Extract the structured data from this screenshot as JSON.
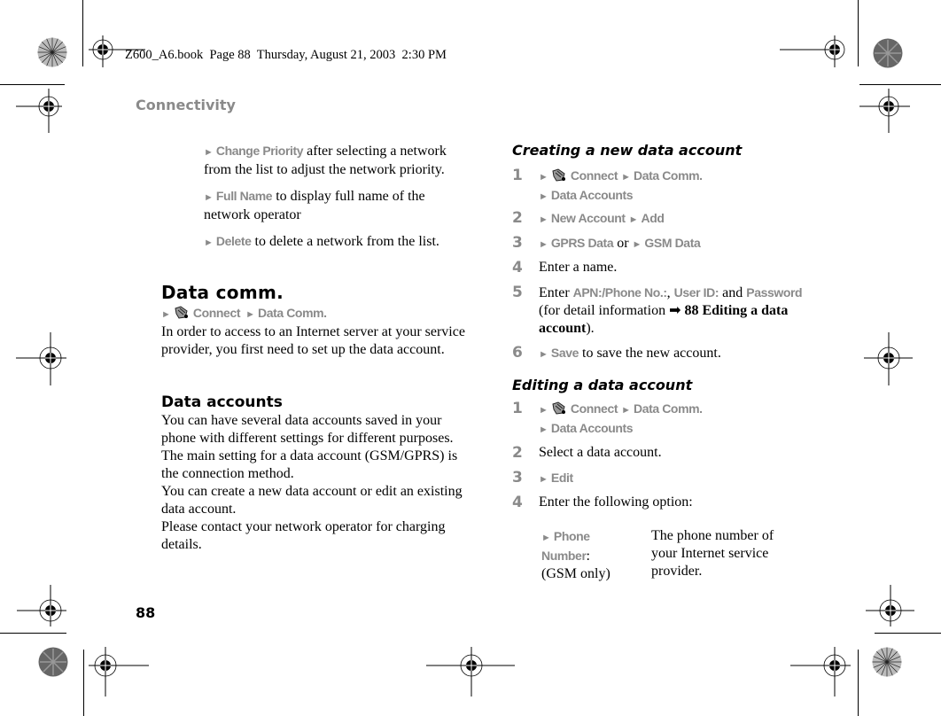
{
  "print_header": "Z600_A6.book  Page 88  Thursday, August 21, 2003  2:30 PM",
  "section_title": "Connectivity",
  "page_number": "88",
  "left_column": {
    "options": [
      {
        "menu": "Change Priority",
        "text": " after selecting a network from the list to adjust the network priority."
      },
      {
        "menu": "Full Name",
        "text": " to display full name of the network operator"
      },
      {
        "menu": "Delete",
        "text": " to delete a network from the list."
      }
    ],
    "data_comm": {
      "heading": "Data comm.",
      "path": {
        "item1": "Connect",
        "item2": "Data Comm."
      },
      "body": "In order to access to an Internet server at your service provider, you first need to set up the data account."
    },
    "data_accounts": {
      "heading": "Data accounts",
      "para1": "You can have several data accounts saved in your phone with different settings for different purposes. The main setting for a data account (GSM/GPRS) is the connection method.",
      "para2": "You can create a new data account or edit an existing data account.",
      "para3": "Please contact your network operator for charging details."
    }
  },
  "right_column": {
    "creating": {
      "heading": "Creating a new data account",
      "steps": [
        {
          "num": "1",
          "a": "Connect",
          "b": "Data Comm.",
          "c": "Data Accounts"
        },
        {
          "num": "2",
          "a": "New Account",
          "b": "Add"
        },
        {
          "num": "3",
          "a": "GPRS Data",
          "or": " or ",
          "b": "GSM Data"
        },
        {
          "num": "4",
          "text": "Enter a name."
        },
        {
          "num": "5",
          "prefix": "Enter ",
          "f1": "APN:/Phone No.:",
          "sep": ", ",
          "f2": "User ID:",
          "and": " and ",
          "f3": "Password",
          "ref_pre": "(for detail information ",
          "ref_arrow": "➡",
          "ref_bold": " 88 Editing a data account",
          "ref_post": ")."
        },
        {
          "num": "6",
          "menu": "Save",
          "text": " to save the new account."
        }
      ]
    },
    "editing": {
      "heading": "Editing a data account",
      "steps": [
        {
          "num": "1",
          "a": "Connect",
          "b": "Data Comm.",
          "c": "Data Accounts"
        },
        {
          "num": "2",
          "text": "Select a data account."
        },
        {
          "num": "3",
          "menu": "Edit"
        },
        {
          "num": "4",
          "text": "Enter the following option:"
        }
      ],
      "option_table": {
        "label_menu_1": "Phone",
        "label_menu_2": "Number",
        "label_colon": ":",
        "label_note": "(GSM only)",
        "description": "The phone number of your Internet service provider."
      }
    }
  },
  "icons": {
    "menu_arrow": "►",
    "connect": "connect-icon"
  }
}
